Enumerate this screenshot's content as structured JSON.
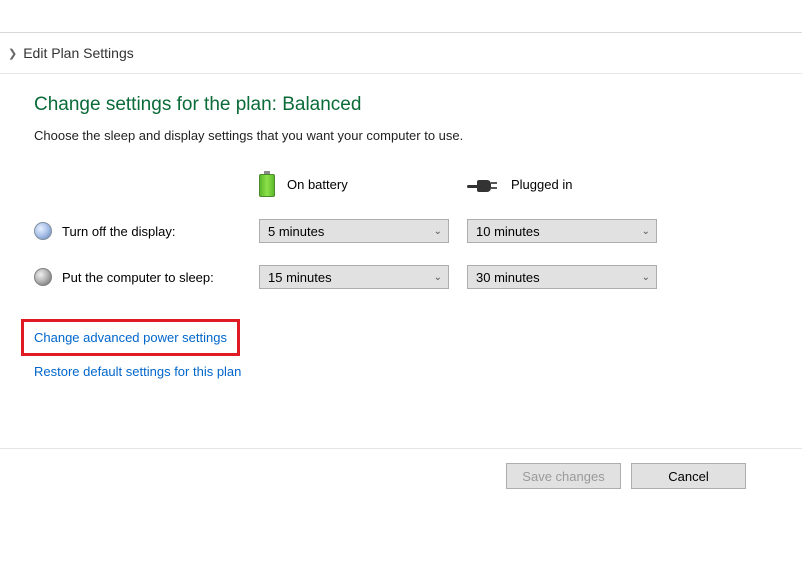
{
  "breadcrumb": {
    "text": "Edit Plan Settings"
  },
  "title": "Change settings for the plan: Balanced",
  "subtitle": "Choose the sleep and display settings that you want your computer to use.",
  "columns": {
    "battery_label": "On battery",
    "plugged_label": "Plugged in"
  },
  "settings": {
    "display": {
      "label": "Turn off the display:",
      "battery_value": "5 minutes",
      "plugged_value": "10 minutes"
    },
    "sleep": {
      "label": "Put the computer to sleep:",
      "battery_value": "15 minutes",
      "plugged_value": "30 minutes"
    }
  },
  "links": {
    "advanced": "Change advanced power settings",
    "restore": "Restore default settings for this plan"
  },
  "buttons": {
    "save": "Save changes",
    "cancel": "Cancel"
  }
}
